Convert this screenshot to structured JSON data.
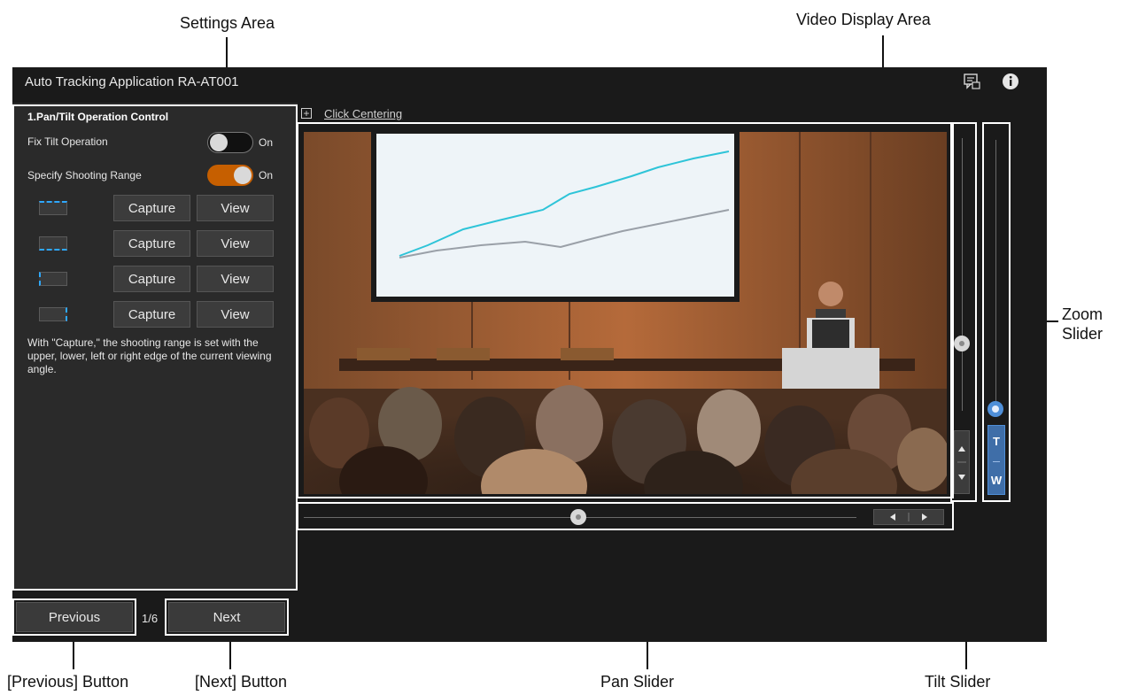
{
  "callouts": {
    "settings_area": "Settings Area",
    "video_display_area": "Video Display Area",
    "zoom_slider_line1": "Zoom",
    "zoom_slider_line2": "Slider",
    "previous_button": "[Previous] Button",
    "next_button": "[Next] Button",
    "pan_slider": "Pan Slider",
    "tilt_slider": "Tilt Slider"
  },
  "app": {
    "title": "Auto Tracking Application RA-AT001",
    "icons": [
      "chat-icon",
      "info-icon"
    ]
  },
  "settings": {
    "section_title": "1.Pan/Tilt Operation Control",
    "fix_tilt_label": "Fix Tilt Operation",
    "fix_tilt_state": "On",
    "fix_tilt_enabled": false,
    "shooting_range_label": "Specify Shooting Range",
    "shooting_range_state": "On",
    "shooting_range_enabled": true,
    "ranges": [
      {
        "edge": "upper",
        "capture": "Capture",
        "view": "View"
      },
      {
        "edge": "lower",
        "capture": "Capture",
        "view": "View"
      },
      {
        "edge": "left",
        "capture": "Capture",
        "view": "View"
      },
      {
        "edge": "right",
        "capture": "Capture",
        "view": "View"
      }
    ],
    "note": "With \"Capture,\" the shooting range is set with the upper, lower, left or right edge of the current viewing angle."
  },
  "click_centering": {
    "icon": "+",
    "label": "Click Centering"
  },
  "zoom": {
    "tele_label": "T",
    "wide_label": "W",
    "accent": "#4f8fd8"
  },
  "navigation": {
    "previous": "Previous",
    "page": "1/6",
    "next": "Next"
  },
  "colors": {
    "toggle_on": "#c65f00",
    "toggle_off": "#111111",
    "range_edge": "#2ea8ff",
    "window_bg": "#1a1a1a",
    "panel_bg": "#2a2a2a"
  }
}
